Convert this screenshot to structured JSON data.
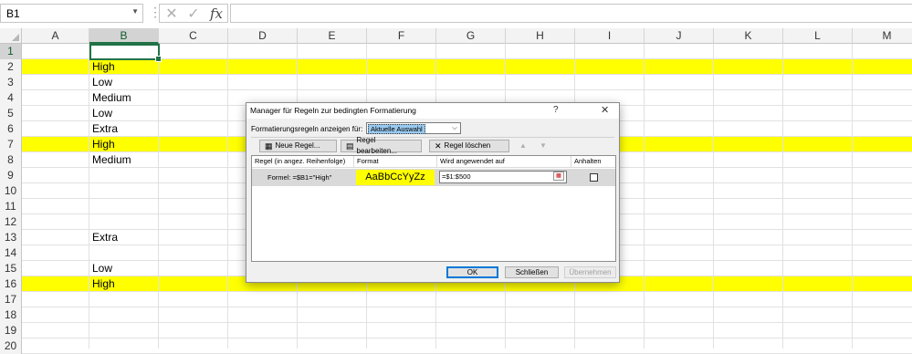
{
  "formula_bar": {
    "name_box": "B1",
    "formula": ""
  },
  "columns": [
    "A",
    "B",
    "C",
    "D",
    "E",
    "F",
    "G",
    "H",
    "I",
    "J",
    "K",
    "L",
    "M"
  ],
  "rows": [
    {
      "n": "1",
      "b": "",
      "highlight": false
    },
    {
      "n": "2",
      "b": "High",
      "highlight": true
    },
    {
      "n": "3",
      "b": "Low",
      "highlight": false
    },
    {
      "n": "4",
      "b": "Medium",
      "highlight": false
    },
    {
      "n": "5",
      "b": "Low",
      "highlight": false
    },
    {
      "n": "6",
      "b": "Extra",
      "highlight": false
    },
    {
      "n": "7",
      "b": "High",
      "highlight": true
    },
    {
      "n": "8",
      "b": "Medium",
      "highlight": false
    },
    {
      "n": "9",
      "b": "",
      "highlight": false
    },
    {
      "n": "10",
      "b": "",
      "highlight": false
    },
    {
      "n": "11",
      "b": "",
      "highlight": false
    },
    {
      "n": "12",
      "b": "",
      "highlight": false
    },
    {
      "n": "13",
      "b": "Extra",
      "highlight": false
    },
    {
      "n": "14",
      "b": "",
      "highlight": false
    },
    {
      "n": "15",
      "b": "Low",
      "highlight": false
    },
    {
      "n": "16",
      "b": "High",
      "highlight": true
    },
    {
      "n": "17",
      "b": "",
      "highlight": false
    },
    {
      "n": "18",
      "b": "",
      "highlight": false
    },
    {
      "n": "19",
      "b": "",
      "highlight": false
    },
    {
      "n": "20",
      "b": "",
      "highlight": false
    }
  ],
  "colors": {
    "highlight": "#ffff00",
    "accent": "#217346"
  },
  "dialog": {
    "title": "Manager für Regeln zur bedingten Formatierung",
    "help": "?",
    "close": "✕",
    "show_label": "Formatierungsregeln anzeigen für:",
    "scope_value": "Aktuelle Auswahl",
    "new_rule": "Neue Regel...",
    "edit_rule": "Regel bearbeiten...",
    "delete_rule": "Regel löschen",
    "move_up": "▲",
    "move_down": "▼",
    "headers": {
      "rule": "Regel (in angez. Reihenfolge)",
      "format": "Format",
      "applies": "Wird angewendet auf",
      "stop": "Anhalten"
    },
    "rule": {
      "text": "Formel: =$B1=\"High\"",
      "preview": "AaBbCcYyZz",
      "applies_to": "=$1:$500",
      "stop_checked": false
    },
    "ok": "OK",
    "close_btn": "Schließen",
    "apply": "Übernehmen"
  }
}
